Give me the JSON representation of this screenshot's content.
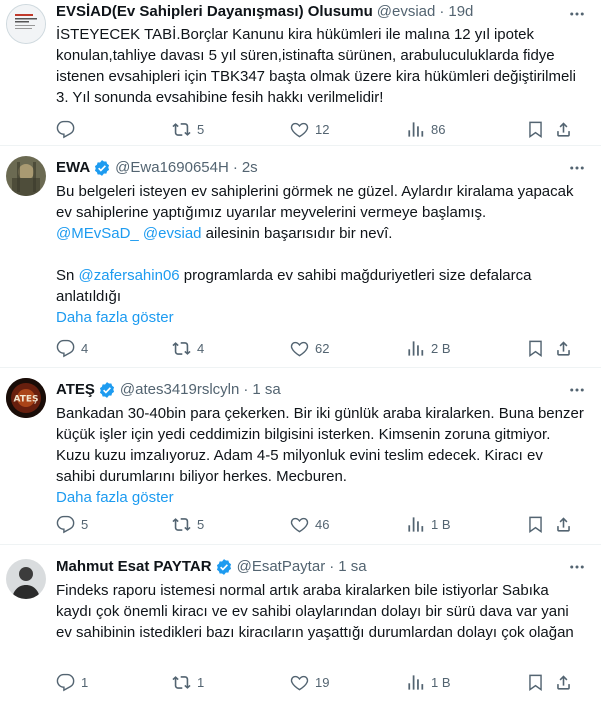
{
  "colors": {
    "accent": "#1d9bf0",
    "text": "#0f1419",
    "muted": "#536471",
    "border": "#eff3f4"
  },
  "tweets": [
    {
      "name": "EVSİAD(Ev Sahipleri Dayanışması) Olusumu",
      "handle": "@evsiad",
      "dot": "·",
      "time": "19d",
      "body": "İSTEYECEK TABİ.Borçlar Kanunu kira hükümleri ile malına 12 yıl ipotek konulan,tahliye davası 5 yıl süren,istinafta sürünen, arabuluculuklarda fidye istenen evsahipleri için TBK347 başta olmak üzere kira hükümleri değiştirilmeli 3. Yıl sonunda evsahibine fesih hakkı verilmelidir!",
      "replies": "",
      "retweets": "5",
      "likes": "12",
      "views": "86"
    },
    {
      "name": "EWA",
      "handle": "@Ewa1690654H",
      "dot": "·",
      "time": "2s",
      "body_p1": "Bu belgeleri isteyen ev sahiplerini görmek ne güzel. Aylardır kiralama yapacak ev sahiplerine yaptığımız uyarılar meyvelerini vermeye başlamış.",
      "mention1": "@MEvSaD_",
      "mention2": "@evsiad",
      "body_p1_tail": " ailesinin başarısıdır bir nevî.",
      "body_p2_lead": "Sn ",
      "mention3": "@zafersahin06",
      "body_p2_tail": " programlarda ev sahibi mağduriyetleri size defalarca anlatıldığı",
      "show_more": "Daha fazla göster",
      "replies": "4",
      "retweets": "4",
      "likes": "62",
      "views": "2 B"
    },
    {
      "name": "ATEŞ",
      "handle": "@ates3419rslcyln",
      "dot": "·",
      "time": "1 sa",
      "body": "Bankadan 30-40bin para çekerken. Bir iki günlük araba kiralarken. Buna benzer küçük işler için yedi ceddimizin bilgisini isterken. Kimsenin zoruna gitmiyor. Kuzu kuzu imzalıyoruz. Adam 4-5 milyonluk evini teslim edecek. Kiracı ev sahibi durumlarını biliyor herkes. Mecburen.",
      "show_more": "Daha fazla göster",
      "avatar_text": "ATEŞ",
      "replies": "5",
      "retweets": "5",
      "likes": "46",
      "views": "1 B"
    },
    {
      "name": "Mahmut Esat PAYTAR",
      "handle": "@EsatPaytar",
      "dot": "·",
      "time": "1 sa",
      "body": "Findeks raporu istemesi normal artık araba kiralarken bile istiyorlar Sabıka kaydı çok önemli kiracı ve ev sahibi olaylarından dolayı bir sürü dava var yani ev sahibinin istedikleri bazı kiracıların yaşattığı durumlardan dolayı çok olağan",
      "replies": "1",
      "retweets": "1",
      "likes": "19",
      "views": "1 B"
    }
  ]
}
